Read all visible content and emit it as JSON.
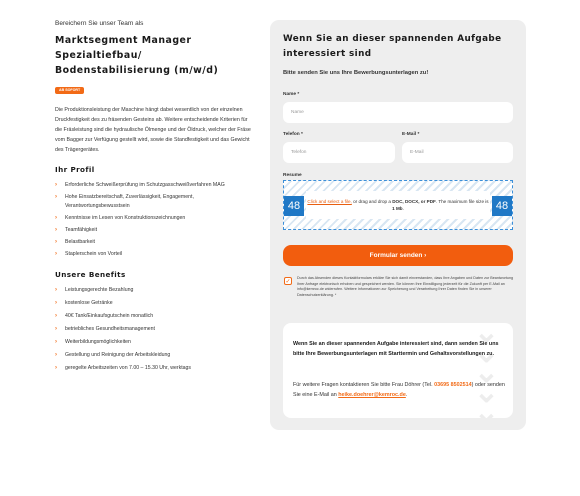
{
  "intro": "Bereichern Sie unser Team als",
  "job_title": [
    "Marktsegment Manager",
    "Spezialtiefbau/",
    "Bodenstabilisierung (m/w/d)"
  ],
  "badge": "AB SOFORT",
  "description": "Die Produktionsleistung der Maschine hängt dabei wesentlich von der einzelnen Druckfestigkeit des zu fräsenden Gesteins ab. Weitere entscheidende Kriterien für die Fräsleistung sind die hydraulische Ölmenge und der Öldruck, welcher der Fräse vom Bagger zur Verfügung gestellt wird, sowie die Standfestigkeit und das Gewicht des Trägergerätes.",
  "profile": {
    "heading": "Ihr Profil",
    "items": [
      "Erforderliche Schweißerprüfung im Schutzgasschweißverfahren MAG",
      "Hohe Einsatzbereitschaft, Zuverlässigkeit, Engagement, Verantwortungsbewusstsein",
      "Kenntnisse im Lesen von Konstruktionszeichnungen",
      "Teamfähigkeit",
      "Belastbarkeit",
      "Staplerschein von Vorteil"
    ]
  },
  "benefits": {
    "heading": "Unsere Benefits",
    "items": [
      "Leistungsgerechte Bezahlung",
      "kostenlose Getränke",
      "40€ Tank/Einkaufsgutschein monatlich",
      "betriebliches Gesundheitsmanagement",
      "Weiterbildungsmöglichkeiten",
      "Gestellung und Reinigung der Arbeitskleidung",
      "geregelte Arbeitszeiten von 7.00 – 15.30 Uhr, werktags"
    ]
  },
  "form": {
    "title": "Wenn Sie an dieser spannenden Aufgabe interessiert sind",
    "subtitle": "Bitte senden Sie uns Ihre Bewerbungsunterlagen zu!",
    "name_label": "Name *",
    "name_placeholder": "Name",
    "phone_label": "Telefon *",
    "phone_placeholder": "Telefon",
    "email_label": "E-Mail *",
    "email_placeholder": "E-Mail",
    "resume_label": "Resume",
    "upload_link": "Click and select a file,",
    "upload_text": " or drag and drop a ",
    "upload_formats": "DOC, DOCX, or PDF",
    "upload_size_text": ". The maximum file size is ",
    "upload_size": "1 Mb",
    "upload_end": ".",
    "upload_number": "48",
    "submit_label": "Formular senden ›",
    "consent_checked": true,
    "consent_text": "Durch das Absenden dieses Kontaktformulars erkläre Sie sich damit einverstanden, dass Ihre Angaben und Daten zur Beantwortung Ihrer Anfrage elektronisch erhoben und gespeichert werden. Sie können Ihre Einwilligung jederzeit für die Zukunft per E-Mail an info@kemroc.de widerrufen. Weitere Informationen zur Speicherung und Verarbeitung Ihrer Daten finden Sie in unserer Datenschutzerklärung. *"
  },
  "info": {
    "bold_text": "Wenn Sie an dieser spannenden Aufgabe interessiert sind, dann senden Sie uns bitte Ihre Bewerbungsunterlagen mit Starttermin und Gehaltsvorstellungen zu.",
    "text_before": "Für weitere Fragen kontaktieren Sie bitte Frau Döhrer (Tel. ",
    "phone": "03695 8502514",
    "text_mid": ") oder senden Sie eine E-Mail an ",
    "email": "heike.doehrer@kemroc.de",
    "text_end": "."
  },
  "colors": {
    "accent": "#f26a16",
    "upload_blue": "#1f78c6",
    "card_bg": "#eeeeee"
  }
}
